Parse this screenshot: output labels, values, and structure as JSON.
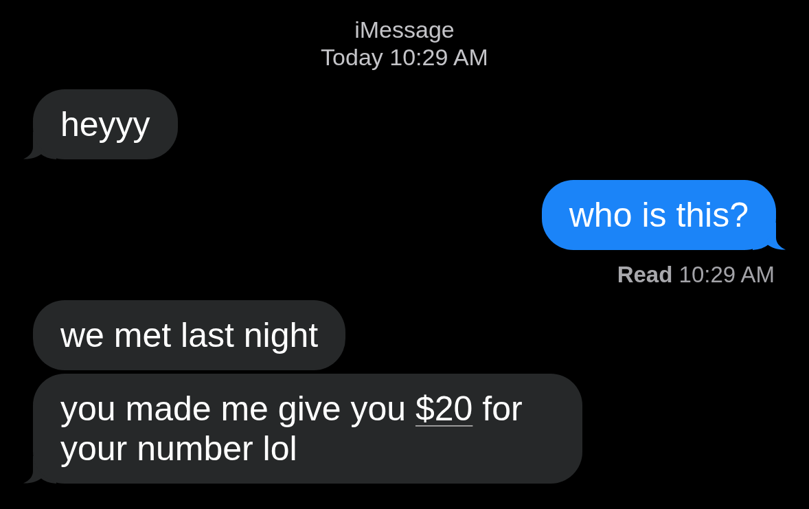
{
  "header": {
    "service": "iMessage",
    "timestamp": "Today 10:29 AM"
  },
  "messages": [
    {
      "kind": "incoming",
      "parts": [
        {
          "kind": "text",
          "text": "heyyy"
        }
      ]
    },
    {
      "kind": "outgoing",
      "parts": [
        {
          "kind": "text",
          "text": "who is this?"
        }
      ],
      "receipt": "**Read** 10:29 AM"
    },
    {
      "kind": "incoming",
      "parts": [
        {
          "kind": "text",
          "text": "we met last night"
        }
      ]
    },
    {
      "kind": "incoming",
      "parts": [
        {
          "kind": "text",
          "text": "you made me give you "
        },
        {
          "kind": "link",
          "text": "$20"
        },
        {
          "kind": "text",
          "text": " for your number lol"
        }
      ]
    }
  ]
}
